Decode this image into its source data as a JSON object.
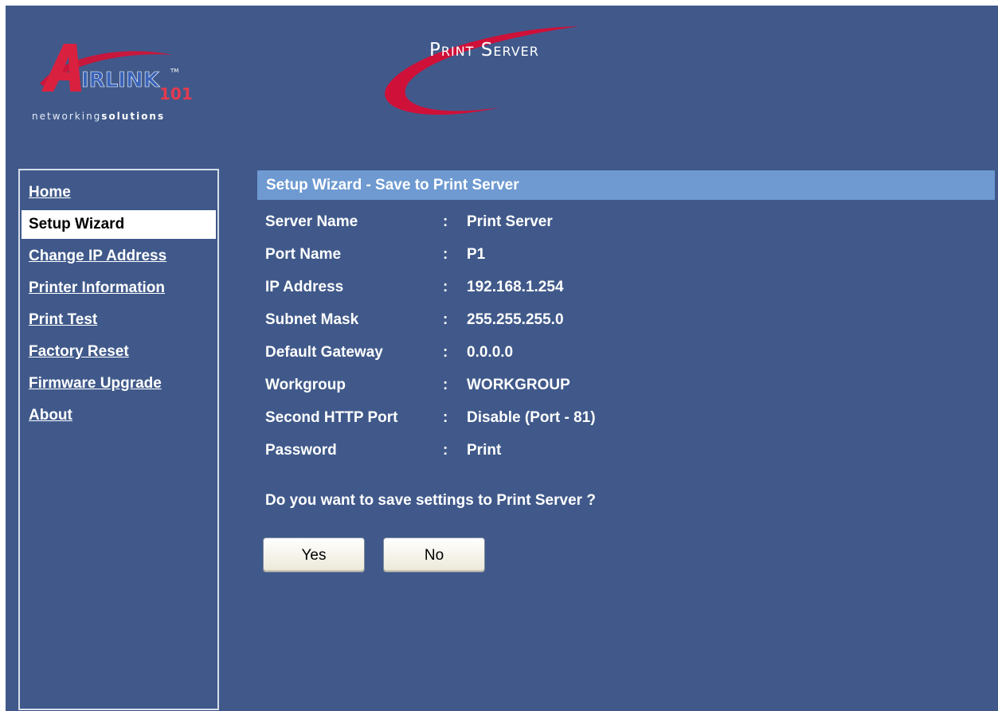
{
  "header": {
    "logo_tagline_light": "networking",
    "logo_tagline_bold": "solutions",
    "brand_title": "Print Server"
  },
  "sidebar": {
    "items": [
      {
        "label": "Home"
      },
      {
        "label": "Setup Wizard",
        "active": true
      },
      {
        "label": "Change IP Address"
      },
      {
        "label": "Printer Information"
      },
      {
        "label": "Print Test"
      },
      {
        "label": "Factory Reset"
      },
      {
        "label": "Firmware Upgrade"
      },
      {
        "label": "About"
      }
    ]
  },
  "main": {
    "section_title": "Setup Wizard - Save to Print Server",
    "rows": [
      {
        "label": "Server Name",
        "colon": ":",
        "value": "Print Server"
      },
      {
        "label": "Port Name",
        "colon": ":",
        "value": "P1"
      },
      {
        "label": "IP Address",
        "colon": ":",
        "value": "192.168.1.254"
      },
      {
        "label": "Subnet Mask",
        "colon": ":",
        "value": "255.255.255.0"
      },
      {
        "label": "Default Gateway",
        "colon": ":",
        "value": "0.0.0.0"
      },
      {
        "label": "Workgroup",
        "colon": ":",
        "value": "WORKGROUP"
      },
      {
        "label": "Second HTTP Port",
        "colon": ":",
        "value": "Disable (Port - 81)"
      },
      {
        "label": "Password",
        "colon": ":",
        "value": "Print"
      }
    ],
    "question": "Do you want to save settings to Print Server ?",
    "yes_label": "Yes",
    "no_label": "No"
  },
  "colors": {
    "background": "#40598a",
    "header_bar": "#6e9ad1",
    "brand_red": "#d0103a"
  }
}
